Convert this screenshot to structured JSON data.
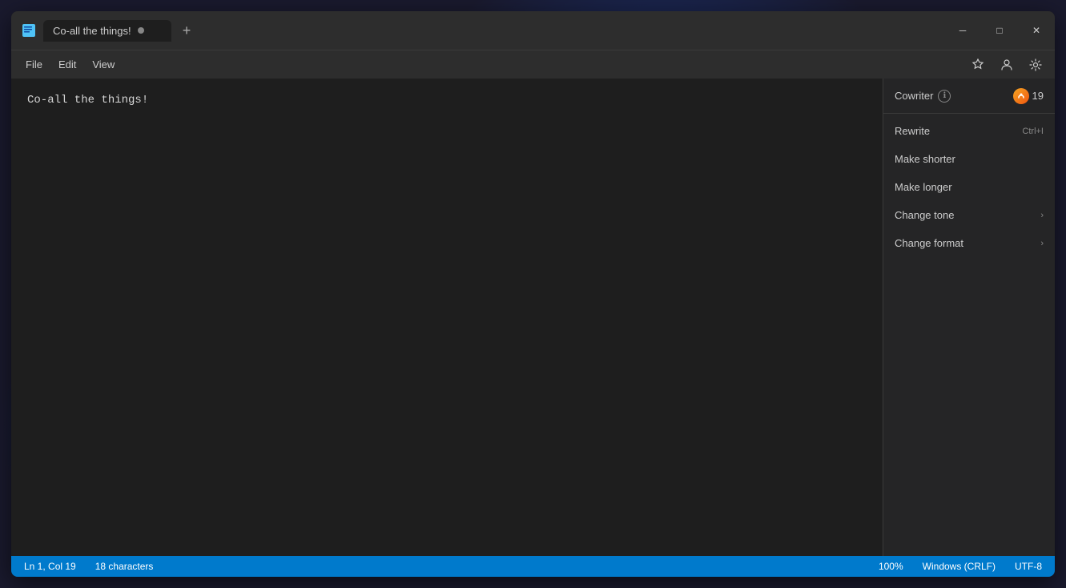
{
  "background": {
    "color": "#1a1a2e"
  },
  "window": {
    "title": "Co-all the things!",
    "tab_dot_visible": true,
    "icon": "notepad"
  },
  "title_bar": {
    "tab_label": "Co-all the things!",
    "add_tab_label": "+",
    "minimize_label": "─",
    "maximize_label": "□",
    "close_label": "✕"
  },
  "menu_bar": {
    "items": [
      "File",
      "Edit",
      "View"
    ],
    "right_icons": [
      "star",
      "account",
      "settings"
    ]
  },
  "editor": {
    "content": "Co-all the things!"
  },
  "cowriter": {
    "title": "Cowriter",
    "info_icon": "ℹ",
    "count": "19",
    "menu_items": [
      {
        "label": "Rewrite",
        "shortcut": "Ctrl+I",
        "has_arrow": false
      },
      {
        "label": "Make shorter",
        "shortcut": "",
        "has_arrow": false
      },
      {
        "label": "Make longer",
        "shortcut": "",
        "has_arrow": false
      },
      {
        "label": "Change tone",
        "shortcut": "",
        "has_arrow": true
      },
      {
        "label": "Change format",
        "shortcut": "",
        "has_arrow": true
      }
    ]
  },
  "status_bar": {
    "left_items": [
      {
        "label": "Ln 1, Col 19"
      },
      {
        "label": "18 characters"
      }
    ],
    "right_items": [
      {
        "label": "100%"
      },
      {
        "label": "Windows (CRLF)"
      },
      {
        "label": "UTF-8"
      }
    ]
  }
}
